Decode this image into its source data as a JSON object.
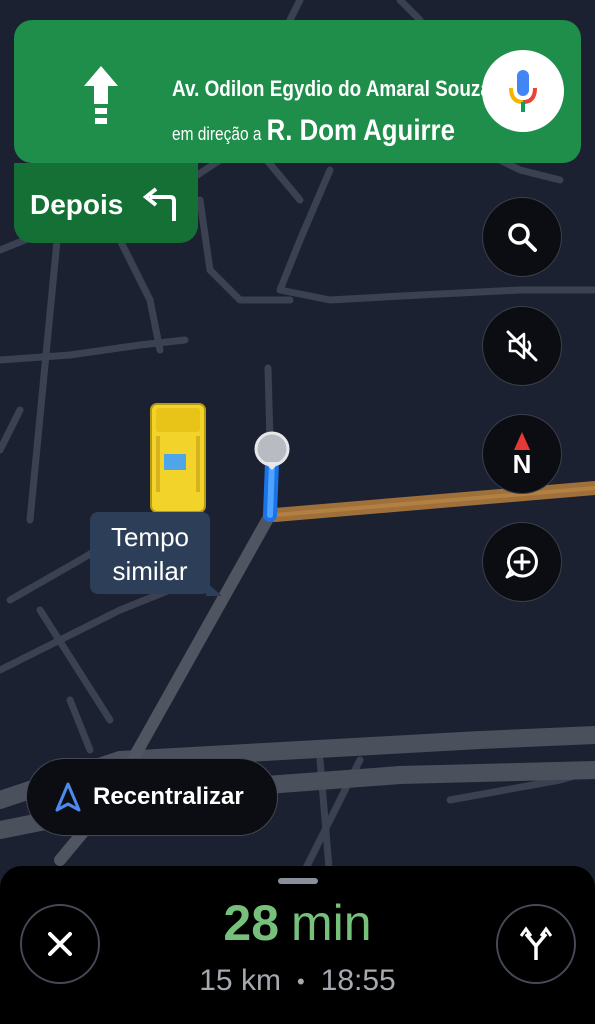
{
  "navigation": {
    "street": "Av. Odilon Egydio do Amaral Souza",
    "toward_prefix": "em direção a",
    "toward_street": "R. Dom Aguirre",
    "maneuver_icon": "straight-arrow-icon",
    "then_label": "Depois",
    "then_icon": "turn-left-arrow-icon"
  },
  "map_controls": [
    {
      "name": "search",
      "icon": "search-icon"
    },
    {
      "name": "mute",
      "icon": "muted-speaker-icon"
    },
    {
      "name": "compass",
      "icon": "compass-icon",
      "label": "N"
    },
    {
      "name": "report",
      "icon": "add-report-icon"
    }
  ],
  "route_callout": "Tempo similar",
  "recenter_label": "Recentralizar",
  "trip": {
    "eta_value": "28",
    "eta_unit": "min",
    "distance": "15 km",
    "arrival_time": "18:55"
  },
  "colors": {
    "instruction_bg": "#1e8e4a",
    "then_bg": "#157035",
    "route": "#a0703a",
    "eta_text": "#77c07c",
    "map_bg": "#1b2130"
  }
}
